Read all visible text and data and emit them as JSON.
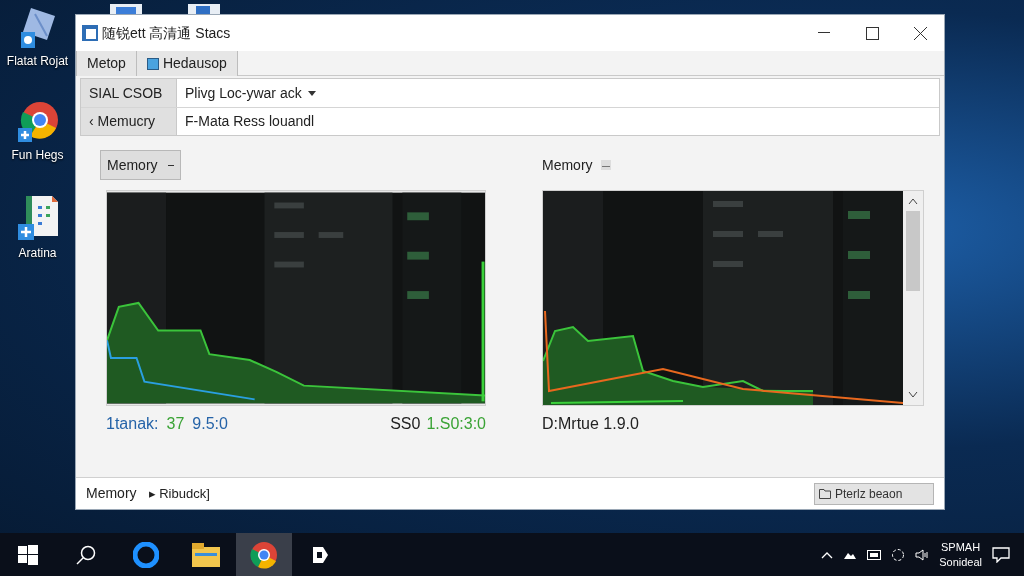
{
  "desktop_icons": [
    {
      "label": "Flatat Rojat"
    },
    {
      "label": "Fun Hegs"
    },
    {
      "label": "Aratina"
    }
  ],
  "window": {
    "title": "随锐ett 高清通 Stacs"
  },
  "tabs": [
    {
      "label": "Metop"
    },
    {
      "label": "Hedausop"
    }
  ],
  "fields": [
    {
      "label": "SIAL CSOB",
      "value": "Plivg Loc-ywar ack",
      "dropdown": true
    },
    {
      "label": "‹ Memucry",
      "value": "F-Mata Ress louandl",
      "dropdown": false
    }
  ],
  "panels": [
    {
      "header": "Memory",
      "kind": "button",
      "scrollbar": false,
      "caption": [
        {
          "text": "1tanak:",
          "color": "#2563a8"
        },
        {
          "text": "37",
          "color": "#3aa335"
        },
        {
          "text": "9.5:0",
          "color": "#2563a8"
        }
      ],
      "caption_right": [
        {
          "text": "SS0",
          "color": "#222222"
        },
        {
          "text": "1.S0:3:0",
          "color": "#3aa335"
        }
      ]
    },
    {
      "header": "Memory",
      "kind": "label",
      "scrollbar": true,
      "caption": [
        {
          "text": "D:Mrtue 1.9.0",
          "color": "#222222"
        }
      ]
    }
  ],
  "status_bar": {
    "label": "Memory",
    "path": "▸ Ribudck]",
    "button": "Pterlz beaon"
  },
  "tray": {
    "line_1": "SPMAH",
    "line_2": "Sonideal"
  }
}
